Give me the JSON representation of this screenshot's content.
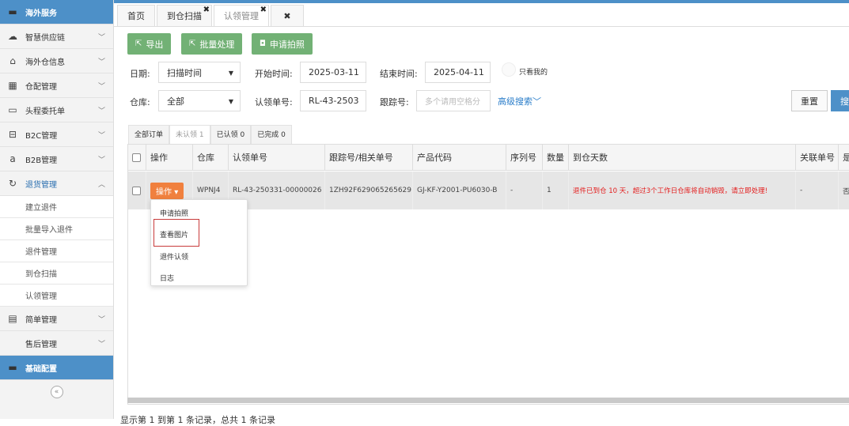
{
  "sidebar": {
    "header": "海外服务",
    "items": [
      {
        "label": "智慧供应链",
        "icon": "cloud-icon"
      },
      {
        "label": "海外仓信息",
        "icon": "home-icon"
      },
      {
        "label": "仓配管理",
        "icon": "grid-icon"
      },
      {
        "label": "头程委托单",
        "icon": "briefcase-icon"
      },
      {
        "label": "B2C管理",
        "icon": "cart-icon"
      },
      {
        "label": "B2B管理",
        "icon": "amazon-icon"
      },
      {
        "label": "退货管理",
        "icon": "refresh-icon"
      }
    ],
    "sub_items": [
      "建立退件",
      "批量导入退件",
      "退件管理",
      "到仓扫描",
      "认领管理"
    ],
    "items_after": [
      {
        "label": "简单管理",
        "icon": "file-icon"
      },
      {
        "label": "售后管理",
        "icon": ""
      }
    ],
    "footer_item": "基础配置",
    "collapse_glyph": "«"
  },
  "tabs": [
    {
      "label": "首页"
    },
    {
      "label": "到仓扫描",
      "close": "✖"
    },
    {
      "label": "认领管理",
      "close": "✖"
    },
    {
      "label": "✖"
    }
  ],
  "toolbar": {
    "export": "导出",
    "batch": "批量处理",
    "photo": "申请拍照"
  },
  "filters": {
    "date_label": "日期:",
    "date_type": "扫描时间",
    "start_label": "开始时间:",
    "start_value": "2025-03-11",
    "end_label": "结束时间:",
    "end_value": "2025-04-11",
    "only_mine": "只看我的",
    "warehouse_label": "仓库:",
    "warehouse_value": "全部",
    "claim_label": "认领单号:",
    "claim_value": "RL-43-2503",
    "tracking_label": "跟踪号:",
    "tracking_placeholder": "多个请用空格分",
    "advanced": "高级搜索",
    "reset": "重置",
    "search": "搜"
  },
  "status_tabs": [
    "全部订单",
    "未认领 1",
    "已认领 0",
    "已完成 0"
  ],
  "table": {
    "headers": [
      "",
      "操作",
      "仓库",
      "认领单号",
      "跟踪号/相关单号",
      "产品代码",
      "序列号",
      "数量",
      "到仓天数",
      "关联单号",
      "是"
    ],
    "row": {
      "op": "操作",
      "warehouse": "WPNJ4",
      "claim_no": "RL-43-250331-00000026",
      "tracking": "1ZH92F629065265629",
      "product": "GJ-KF-Y2001-PU6030-B",
      "serial": "-",
      "qty": "1",
      "days": "退件已到仓 10 天，超过3个工作日仓库将自动销毁，请立即处理!",
      "related": "-",
      "last": "否"
    }
  },
  "dropdown": [
    "申请拍照",
    "查看图片",
    "退件认领",
    "日志"
  ],
  "footer": "显示第 1 到第 1 条记录，总共 1 条记录"
}
